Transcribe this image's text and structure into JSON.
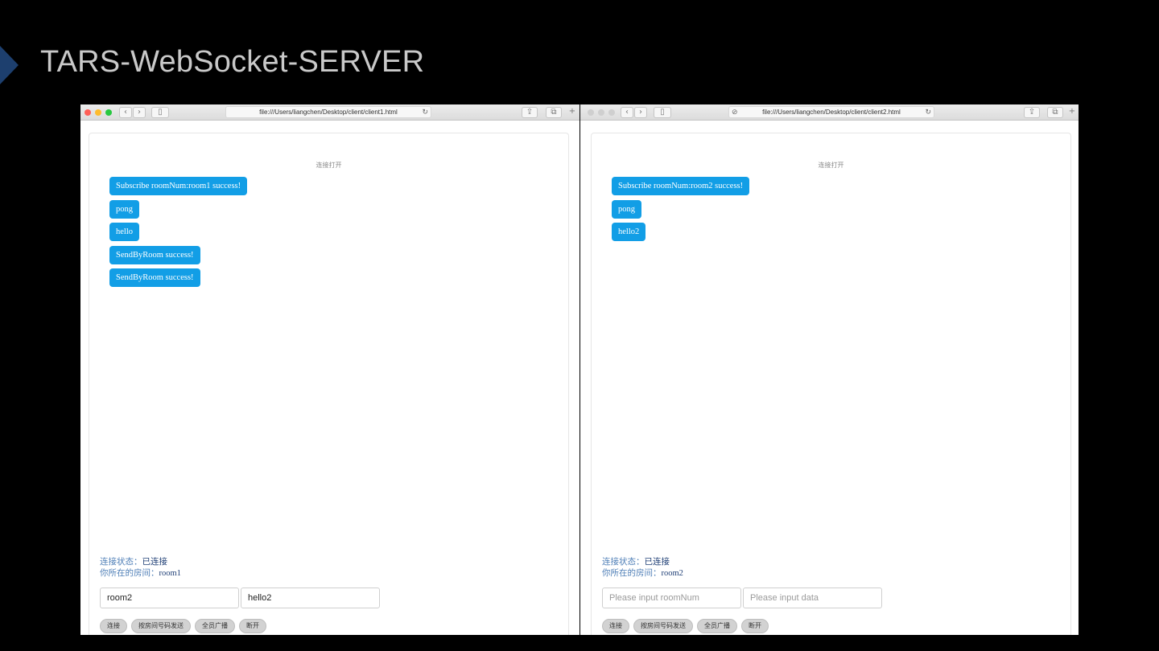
{
  "slide": {
    "title": "TARS-WebSocket-SERVER"
  },
  "clients": [
    {
      "url": "file:///Users/liangchen/Desktop/client/client1.html",
      "connection_open": "连接打开",
      "messages": [
        "Subscribe roomNum:room1 success!",
        "pong",
        "hello",
        "SendByRoom success!",
        "SendByRoom success!"
      ],
      "status_label": "连接状态：",
      "status_value": "已连接",
      "room_label": "你所在的房间：",
      "room_value": "room1",
      "room_input_value": "room2",
      "room_input_placeholder": "",
      "data_input_value": "hello2",
      "data_input_placeholder": "",
      "buttons": [
        "连接",
        "按房间号码发送",
        "全员广播",
        "断开"
      ]
    },
    {
      "url": "file:///Users/liangchen/Desktop/client/client2.html",
      "connection_open": "连接打开",
      "messages": [
        "Subscribe roomNum:room2 success!",
        "pong",
        "hello2"
      ],
      "status_label": "连接状态：",
      "status_value": "已连接",
      "room_label": "你所在的房间：",
      "room_value": "room2",
      "room_input_value": "",
      "room_input_placeholder": "Please input roomNum",
      "data_input_value": "",
      "data_input_placeholder": "Please input data",
      "buttons": [
        "连接",
        "按房间号码发送",
        "全员广播",
        "断开"
      ]
    }
  ],
  "icons": {
    "back": "‹",
    "forward": "›",
    "sidebar": "▯",
    "reload": "↻",
    "share": "⇪",
    "tabs": "⧉",
    "new_tab": "+",
    "info": "⊘"
  },
  "colors": {
    "bubble": "#129ee6",
    "status_label": "#4f7fb7",
    "status_value": "#1e3e75"
  }
}
